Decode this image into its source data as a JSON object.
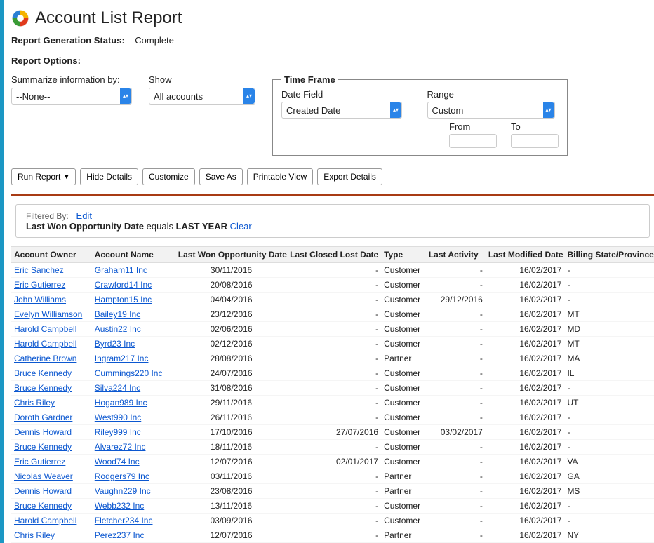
{
  "header": {
    "title": "Account List Report",
    "status_label": "Report Generation Status:",
    "status_value": "Complete",
    "options_label": "Report Options:"
  },
  "summarize": {
    "label": "Summarize information by:",
    "value": "--None--"
  },
  "show": {
    "label": "Show",
    "value": "All accounts"
  },
  "time_frame": {
    "legend": "Time Frame",
    "date_field_label": "Date Field",
    "date_field_value": "Created Date",
    "range_label": "Range",
    "range_value": "Custom",
    "from_label": "From",
    "from_value": "",
    "to_label": "To",
    "to_value": ""
  },
  "toolbar": {
    "run_report": "Run Report",
    "hide_details": "Hide Details",
    "customize": "Customize",
    "save_as": "Save As",
    "printable_view": "Printable View",
    "export_details": "Export Details"
  },
  "filter": {
    "filtered_by": "Filtered By:",
    "edit": "Edit",
    "criterion_field": "Last Won Opportunity Date",
    "criterion_op": "equals",
    "criterion_value": "LAST YEAR",
    "clear": "Clear"
  },
  "columns": {
    "owner": "Account Owner",
    "name": "Account Name",
    "last_won": "Last Won Opportunity Date",
    "last_closed": "Last Closed Lost Date",
    "type": "Type",
    "last_activity": "Last Activity",
    "last_modified": "Last Modified Date",
    "billing": "Billing State/Province"
  },
  "rows": [
    {
      "owner": "Eric Sanchez",
      "name": "Graham11 Inc",
      "last_won": "30/11/2016",
      "last_closed": "-",
      "type": "Customer",
      "last_activity": "-",
      "last_modified": "16/02/2017",
      "billing": "-"
    },
    {
      "owner": "Eric Gutierrez",
      "name": "Crawford14 Inc",
      "last_won": "20/08/2016",
      "last_closed": "-",
      "type": "Customer",
      "last_activity": "-",
      "last_modified": "16/02/2017",
      "billing": "-"
    },
    {
      "owner": "John Williams",
      "name": "Hampton15 Inc",
      "last_won": "04/04/2016",
      "last_closed": "-",
      "type": "Customer",
      "last_activity": "29/12/2016",
      "last_modified": "16/02/2017",
      "billing": "-"
    },
    {
      "owner": "Evelyn Williamson",
      "name": "Bailey19 Inc",
      "last_won": "23/12/2016",
      "last_closed": "-",
      "type": "Customer",
      "last_activity": "-",
      "last_modified": "16/02/2017",
      "billing": "MT"
    },
    {
      "owner": "Harold Campbell",
      "name": "Austin22 Inc",
      "last_won": "02/06/2016",
      "last_closed": "-",
      "type": "Customer",
      "last_activity": "-",
      "last_modified": "16/02/2017",
      "billing": "MD"
    },
    {
      "owner": "Harold Campbell",
      "name": "Byrd23 Inc",
      "last_won": "02/12/2016",
      "last_closed": "-",
      "type": "Customer",
      "last_activity": "-",
      "last_modified": "16/02/2017",
      "billing": "MT"
    },
    {
      "owner": "Catherine Brown",
      "name": "Ingram217 Inc",
      "last_won": "28/08/2016",
      "last_closed": "-",
      "type": "Partner",
      "last_activity": "-",
      "last_modified": "16/02/2017",
      "billing": "MA"
    },
    {
      "owner": "Bruce Kennedy",
      "name": "Cummings220 Inc",
      "last_won": "24/07/2016",
      "last_closed": "-",
      "type": "Customer",
      "last_activity": "-",
      "last_modified": "16/02/2017",
      "billing": "IL"
    },
    {
      "owner": "Bruce Kennedy",
      "name": "Silva224 Inc",
      "last_won": "31/08/2016",
      "last_closed": "-",
      "type": "Customer",
      "last_activity": "-",
      "last_modified": "16/02/2017",
      "billing": "-"
    },
    {
      "owner": "Chris Riley",
      "name": "Hogan989 Inc",
      "last_won": "29/11/2016",
      "last_closed": "-",
      "type": "Customer",
      "last_activity": "-",
      "last_modified": "16/02/2017",
      "billing": "UT"
    },
    {
      "owner": "Doroth Gardner",
      "name": "West990 Inc",
      "last_won": "26/11/2016",
      "last_closed": "-",
      "type": "Customer",
      "last_activity": "-",
      "last_modified": "16/02/2017",
      "billing": "-"
    },
    {
      "owner": "Dennis Howard",
      "name": "Riley999 Inc",
      "last_won": "17/10/2016",
      "last_closed": "27/07/2016",
      "type": "Customer",
      "last_activity": "03/02/2017",
      "last_modified": "16/02/2017",
      "billing": "-"
    },
    {
      "owner": "Bruce Kennedy",
      "name": "Alvarez72 Inc",
      "last_won": "18/11/2016",
      "last_closed": "-",
      "type": "Customer",
      "last_activity": "-",
      "last_modified": "16/02/2017",
      "billing": "-"
    },
    {
      "owner": "Eric Gutierrez",
      "name": "Wood74 Inc",
      "last_won": "12/07/2016",
      "last_closed": "02/01/2017",
      "type": "Customer",
      "last_activity": "-",
      "last_modified": "16/02/2017",
      "billing": "VA"
    },
    {
      "owner": "Nicolas Weaver",
      "name": "Rodgers79 Inc",
      "last_won": "03/11/2016",
      "last_closed": "-",
      "type": "Partner",
      "last_activity": "-",
      "last_modified": "16/02/2017",
      "billing": "GA"
    },
    {
      "owner": "Dennis Howard",
      "name": "Vaughn229 Inc",
      "last_won": "23/08/2016",
      "last_closed": "-",
      "type": "Partner",
      "last_activity": "-",
      "last_modified": "16/02/2017",
      "billing": "MS"
    },
    {
      "owner": "Bruce Kennedy",
      "name": "Webb232 Inc",
      "last_won": "13/11/2016",
      "last_closed": "-",
      "type": "Customer",
      "last_activity": "-",
      "last_modified": "16/02/2017",
      "billing": "-"
    },
    {
      "owner": "Harold Campbell",
      "name": "Fletcher234 Inc",
      "last_won": "03/09/2016",
      "last_closed": "-",
      "type": "Customer",
      "last_activity": "-",
      "last_modified": "16/02/2017",
      "billing": "-"
    },
    {
      "owner": "Chris Riley",
      "name": "Perez237 Inc",
      "last_won": "12/07/2016",
      "last_closed": "-",
      "type": "Partner",
      "last_activity": "-",
      "last_modified": "16/02/2017",
      "billing": "NY"
    }
  ]
}
